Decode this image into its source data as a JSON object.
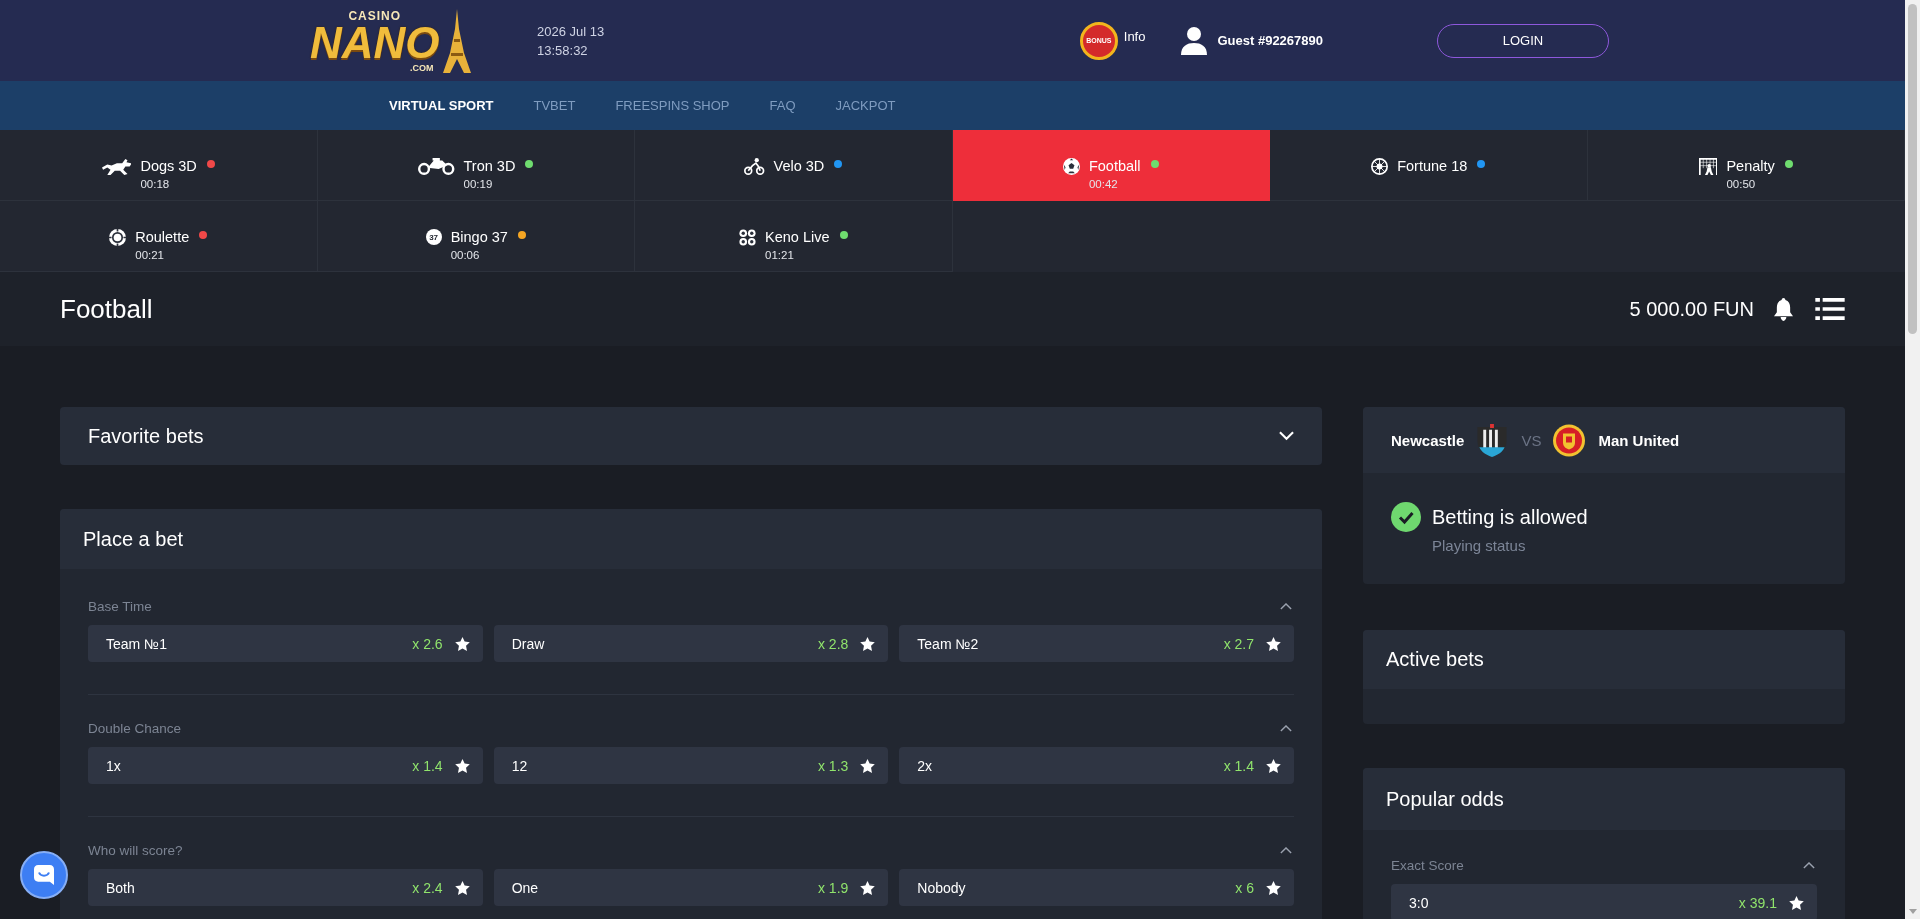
{
  "header": {
    "logo": {
      "top": "CASINO",
      "main": "NANO",
      "sub": ".COM"
    },
    "date": "2026 Jul 13",
    "time": "13:58:32",
    "bonus": {
      "badge": "BONUS",
      "label": "Info"
    },
    "user": "Guest #92267890",
    "login": "LOGIN"
  },
  "nav": [
    {
      "label": "VIRTUAL SPORT",
      "selected": true
    },
    {
      "label": "TVBET",
      "selected": false
    },
    {
      "label": "FREESPINS SHOP",
      "selected": false
    },
    {
      "label": "FAQ",
      "selected": false
    },
    {
      "label": "JACKPOT",
      "selected": false
    }
  ],
  "games": [
    {
      "name": "Dogs 3D",
      "time": "00:18",
      "color": "#f04848",
      "selected": false
    },
    {
      "name": "Tron 3D",
      "time": "00:19",
      "color": "#6fdc6f",
      "selected": false
    },
    {
      "name": "Velo 3D",
      "color": "#2196f3",
      "selected": false
    },
    {
      "name": "Football",
      "time": "00:42",
      "color": "#6fdc6f",
      "selected": true
    },
    {
      "name": "Fortune 18",
      "color": "#2196f3",
      "selected": false
    },
    {
      "name": "Penalty",
      "time": "00:50",
      "color": "#6fdc6f",
      "selected": false
    },
    {
      "name": "Roulette",
      "time": "00:21",
      "color": "#f04848",
      "selected": false
    },
    {
      "name": "Bingo 37",
      "time": "00:06",
      "color": "#f5a623",
      "selected": false,
      "icon_text": "37"
    },
    {
      "name": "Keno Live",
      "time": "01:21",
      "color": "#6fdc6f",
      "selected": false
    }
  ],
  "title_bar": {
    "title": "Football",
    "balance": "5 000.00 FUN"
  },
  "favorites": {
    "title": "Favorite bets",
    "expanded": false
  },
  "place_bet": {
    "title": "Place a bet",
    "markets": [
      {
        "label": "Base Time",
        "expanded": true,
        "options": [
          {
            "label": "Team №1",
            "odds": "x 2.6"
          },
          {
            "label": "Draw",
            "odds": "x 2.8"
          },
          {
            "label": "Team №2",
            "odds": "x 2.7"
          }
        ]
      },
      {
        "label": "Double Chance",
        "expanded": true,
        "options": [
          {
            "label": "1x",
            "odds": "x 1.4"
          },
          {
            "label": "12",
            "odds": "x 1.3"
          },
          {
            "label": "2x",
            "odds": "x 1.4"
          }
        ]
      },
      {
        "label": "Who will score?",
        "expanded": true,
        "options": [
          {
            "label": "Both",
            "odds": "x 2.4"
          },
          {
            "label": "One",
            "odds": "x 1.9"
          },
          {
            "label": "Nobody",
            "odds": "x 6"
          }
        ]
      }
    ]
  },
  "match": {
    "home": "Newcastle",
    "vs": "VS",
    "away": "Man United",
    "status": {
      "allowed": true,
      "title": "Betting is allowed",
      "subtitle": "Playing status"
    }
  },
  "active_bets": {
    "title": "Active bets"
  },
  "popular_odds": {
    "title": "Popular odds",
    "markets": [
      {
        "label": "Exact Score",
        "expanded": true,
        "options": [
          {
            "label": "3:0",
            "odds": "x 39.1"
          }
        ]
      }
    ]
  }
}
